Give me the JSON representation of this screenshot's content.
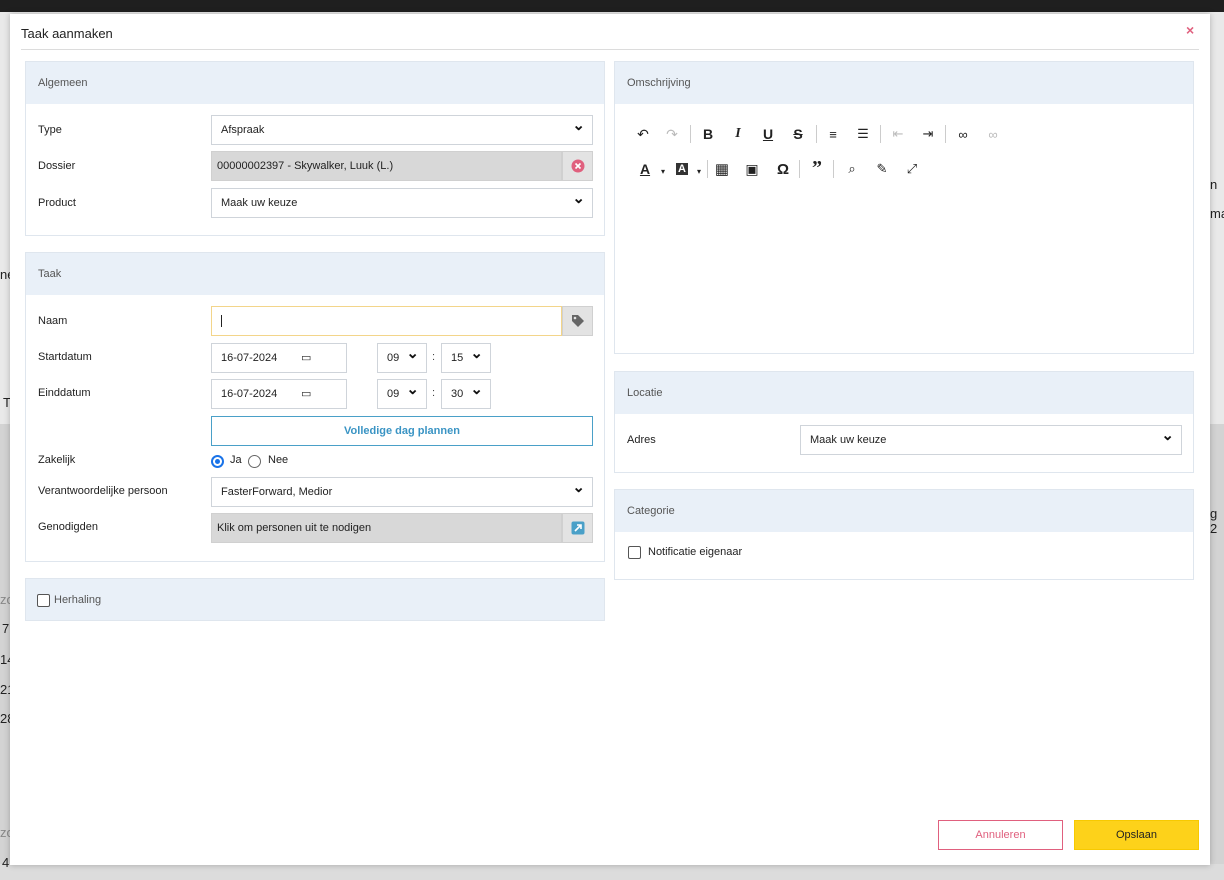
{
  "modal": {
    "title": "Taak aanmaken",
    "close_icon": "×"
  },
  "background": {
    "fragments": [
      "n",
      "ma",
      "ne",
      "T",
      "g 2",
      "zo",
      "7",
      "14",
      "21",
      "28",
      "zo",
      "4"
    ]
  },
  "algemeen": {
    "heading": "Algemeen",
    "type_label": "Type",
    "type_value": "Afspraak",
    "dossier_label": "Dossier",
    "dossier_value": "00000002397 - Skywalker, Luuk  (L.)",
    "product_label": "Product",
    "product_value": "Maak uw keuze"
  },
  "taak": {
    "heading": "Taak",
    "naam_label": "Naam",
    "naam_value": "",
    "startdatum_label": "Startdatum",
    "startdatum_value": "16-07-2024",
    "start_hour": "09",
    "start_minute": "15",
    "einddatum_label": "Einddatum",
    "einddatum_value": "16-07-2024",
    "end_hour": "09",
    "end_minute": "30",
    "colon": ":",
    "full_day_button": "Volledige dag plannen",
    "zakelijk_label": "Zakelijk",
    "zakelijk_ja": "Ja",
    "zakelijk_nee": "Nee",
    "verantwoordelijke_label": "Verantwoordelijke persoon",
    "verantwoordelijke_value": "FasterForward, Medior",
    "genodigden_label": "Genodigden",
    "genodigden_value": "Klik om personen uit te nodigen"
  },
  "herhaling": {
    "label": "Herhaling"
  },
  "omschrijving": {
    "heading": "Omschrijving"
  },
  "locatie": {
    "heading": "Locatie",
    "adres_label": "Adres",
    "adres_value": "Maak uw keuze"
  },
  "categorie": {
    "heading": "Categorie",
    "notificatie_label": "Notificatie eigenaar"
  },
  "footer": {
    "cancel_label": "Annuleren",
    "save_label": "Opslaan"
  },
  "colors": {
    "accent_blue": "#3a94c4",
    "cancel_pink": "#e0607e",
    "save_yellow": "#fdd21a",
    "panel_header": "#e9f0f8"
  }
}
